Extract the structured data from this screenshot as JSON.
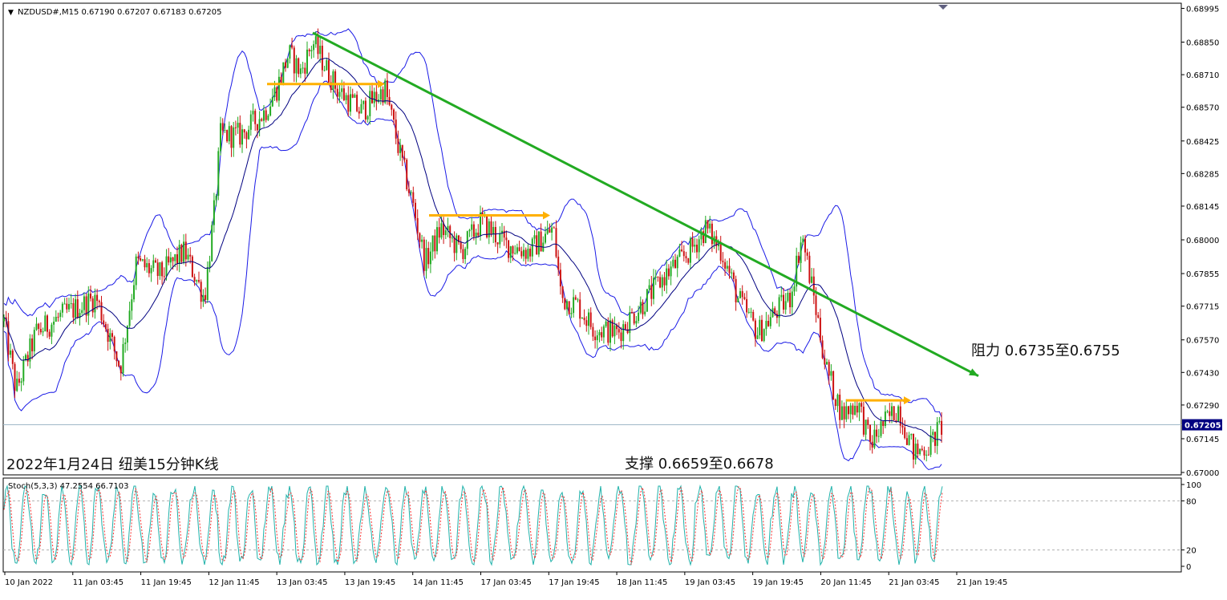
{
  "chart_data": [
    {
      "type": "candlestick",
      "title": "NZDUSD#,M15  0.67190 0.67207 0.67183 0.67205",
      "symbol": "NZDUSD#",
      "timeframe": "M15",
      "ohlc_header": "0.67190 0.67207 0.67183 0.67205",
      "current_price_label": "0.67205",
      "colors": {
        "background": "#ffffff",
        "axis": "#000000",
        "bull_candle": "#22aa22",
        "bear_candle": "#cc1111",
        "bands": "#1a1ae6",
        "middle_band": "#000080",
        "trendline": "#22aa22",
        "level_arrow": "#ffb000",
        "price_line": "#a0b8c8",
        "current_price_box": "#000080",
        "stoch_main": "#20b2aa",
        "stoch_signal": "#ff3030"
      },
      "ylim": [
        0.67,
        0.69
      ],
      "y_ticks": [
        "0.68995",
        "0.68850",
        "0.68710",
        "0.68570",
        "0.68425",
        "0.68285",
        "0.68145",
        "0.68000",
        "0.67855",
        "0.67715",
        "0.67570",
        "0.67430",
        "0.67290",
        "0.67145",
        "0.67000"
      ],
      "x_tick_labels": [
        "10 Jan 2022",
        "11 Jan 03:45",
        "11 Jan 19:45",
        "12 Jan 11:45",
        "13 Jan 03:45",
        "13 Jan 19:45",
        "14 Jan 11:45",
        "17 Jan 03:45",
        "17 Jan 19:45",
        "18 Jan 11:45",
        "19 Jan 03:45",
        "19 Jan 19:45",
        "20 Jan 11:45",
        "21 Jan 03:45",
        "21 Jan 19:45"
      ],
      "price_path": [
        [
          0,
          0.6775
        ],
        [
          20,
          0.6735
        ],
        [
          45,
          0.676
        ],
        [
          80,
          0.6768
        ],
        [
          120,
          0.6775
        ],
        [
          150,
          0.6745
        ],
        [
          170,
          0.679
        ],
        [
          200,
          0.6785
        ],
        [
          230,
          0.6795
        ],
        [
          255,
          0.6775
        ],
        [
          268,
          0.6815
        ],
        [
          275,
          0.6845
        ],
        [
          300,
          0.6845
        ],
        [
          330,
          0.6855
        ],
        [
          345,
          0.6865
        ],
        [
          360,
          0.688
        ],
        [
          375,
          0.6872
        ],
        [
          390,
          0.6885
        ],
        [
          420,
          0.6865
        ],
        [
          450,
          0.6855
        ],
        [
          480,
          0.6865
        ],
        [
          500,
          0.6835
        ],
        [
          515,
          0.6815
        ],
        [
          530,
          0.679
        ],
        [
          550,
          0.6805
        ],
        [
          575,
          0.6795
        ],
        [
          600,
          0.6808
        ],
        [
          630,
          0.6798
        ],
        [
          660,
          0.6795
        ],
        [
          690,
          0.6805
        ],
        [
          700,
          0.6775
        ],
        [
          720,
          0.6772
        ],
        [
          740,
          0.6762
        ],
        [
          770,
          0.676
        ],
        [
          800,
          0.6772
        ],
        [
          830,
          0.6785
        ],
        [
          860,
          0.6795
        ],
        [
          880,
          0.6805
        ],
        [
          900,
          0.6795
        ],
        [
          920,
          0.6775
        ],
        [
          945,
          0.676
        ],
        [
          970,
          0.677
        ],
        [
          985,
          0.6775
        ],
        [
          1000,
          0.6802
        ],
        [
          1015,
          0.6775
        ],
        [
          1030,
          0.6745
        ],
        [
          1050,
          0.6725
        ],
        [
          1070,
          0.673
        ],
        [
          1085,
          0.6712
        ],
        [
          1100,
          0.672
        ],
        [
          1120,
          0.6728
        ],
        [
          1140,
          0.6708
        ],
        [
          1160,
          0.6712
        ],
        [
          1175,
          0.67205
        ]
      ],
      "trendline": [
        [
          390,
          0.6889
        ],
        [
          1220,
          0.67415
        ]
      ],
      "resistance_arrows": [
        [
          [
            333,
            0.6867
          ],
          [
            480,
            0.6867
          ]
        ],
        [
          [
            535,
            0.68105
          ],
          [
            686,
            0.68105
          ]
        ],
        [
          [
            1055,
            0.6731
          ],
          [
            1136,
            0.6731
          ]
        ]
      ],
      "annotations": {
        "resistance": "阻力 0.6735至0.6755",
        "support": "支撑 0.6659至0.6678",
        "caption": "2022年1月24日  纽美15分钟K线"
      }
    },
    {
      "type": "line",
      "title": "Stoch(5,3,3) 47.2554 66.7103",
      "indicator": "Stoch(5,3,3)",
      "main_value": "47.2554",
      "signal_value": "66.7103",
      "ylim": [
        0,
        100
      ],
      "y_ticks": [
        "100",
        "80",
        "20",
        "0"
      ],
      "levels": [
        80,
        20
      ]
    }
  ]
}
